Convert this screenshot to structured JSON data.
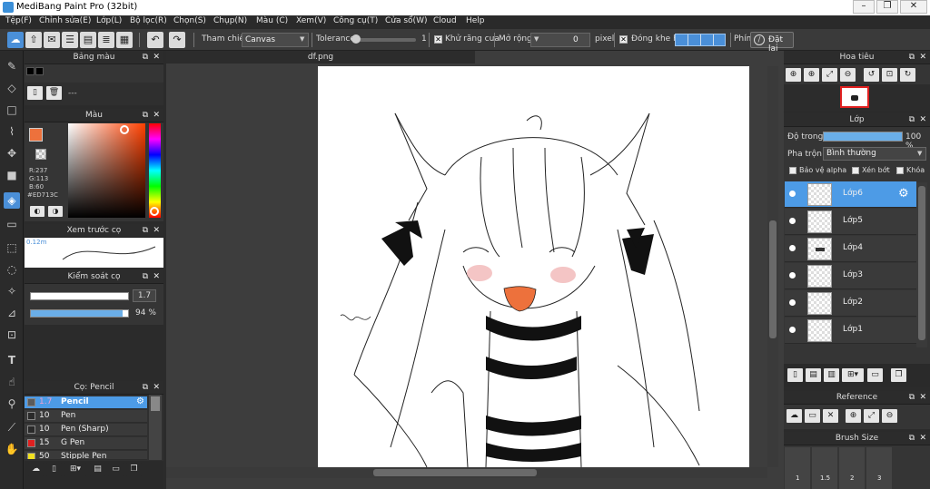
{
  "window": {
    "title": "MediBang Paint Pro (32bit)",
    "minimize": "–",
    "maximize": "❐",
    "close": "✕"
  },
  "menu": [
    "Tệp(F)",
    "Chỉnh sửa(E)",
    "Lớp(L)",
    "Bộ lọc(R)",
    "Chọn(S)",
    "Chụp(N)",
    "Màu (C)",
    "Xem(V)",
    "Công cụ(T)",
    "Cửa sổ(W)",
    "Cloud",
    "Help"
  ],
  "toolbar": {
    "reference_label": "Tham chiếu",
    "reference_value": "Canvas",
    "tolerance_label": "Tolerance",
    "tolerance_value": "1",
    "antialias_label": "Khử răng cưa",
    "expand_label": "Mở rộng",
    "expand_value": "0",
    "expand_unit": "pixel",
    "gap_close_label": "Đóng khe hở",
    "keys_label": "Phím",
    "reset_label": "Đặt lại"
  },
  "palette_panel": {
    "title": "Bảng màu",
    "value": "---"
  },
  "color_panel": {
    "title": "Màu",
    "r": "R:237",
    "g": "G:113",
    "b": "B:60",
    "hex": "#ED713C",
    "current_color": "#ED713C"
  },
  "brush_preview": {
    "title": "Xem trước cọ",
    "size": "0.12m"
  },
  "brush_control": {
    "title": "Kiểm soát cọ",
    "size_value": "1.7",
    "opacity_value": "94 %",
    "opacity_fraction": 0.94
  },
  "brush_list": {
    "title": "Cọ: Pencil",
    "items": [
      {
        "size": "1.7",
        "name": "Pencil",
        "active": true,
        "color": "#5b5b5b"
      },
      {
        "size": "10",
        "name": "Pen",
        "color": "#2a2a2a"
      },
      {
        "size": "10",
        "name": "Pen (Sharp)",
        "color": "#2a2a2a"
      },
      {
        "size": "15",
        "name": "G Pen",
        "color": "#e02020"
      },
      {
        "size": "50",
        "name": "Stipple Pen",
        "color": "#f0e020"
      }
    ]
  },
  "document": {
    "tab": "df.png"
  },
  "navigator": {
    "title": "Hoa tiêu"
  },
  "layer_panel": {
    "title": "Lớp",
    "opacity_label": "Độ trong",
    "opacity_value": "100 %",
    "opacity_fraction": 1.0,
    "blend_label": "Pha trộn",
    "blend_value": "Bình thường",
    "protect_alpha": "Bảo vệ alpha",
    "clipping": "Xén bớt",
    "lock": "Khóa",
    "layers": [
      {
        "name": "Lớp6",
        "active": true
      },
      {
        "name": "Lớp5"
      },
      {
        "name": "Lớp4"
      },
      {
        "name": "Lớp3"
      },
      {
        "name": "Lớp2"
      },
      {
        "name": "Lớp1"
      }
    ]
  },
  "reference_panel": {
    "title": "Reference"
  },
  "brush_size_panel": {
    "title": "Brush Size",
    "sizes": [
      "1",
      "1.5",
      "2",
      "3"
    ]
  }
}
